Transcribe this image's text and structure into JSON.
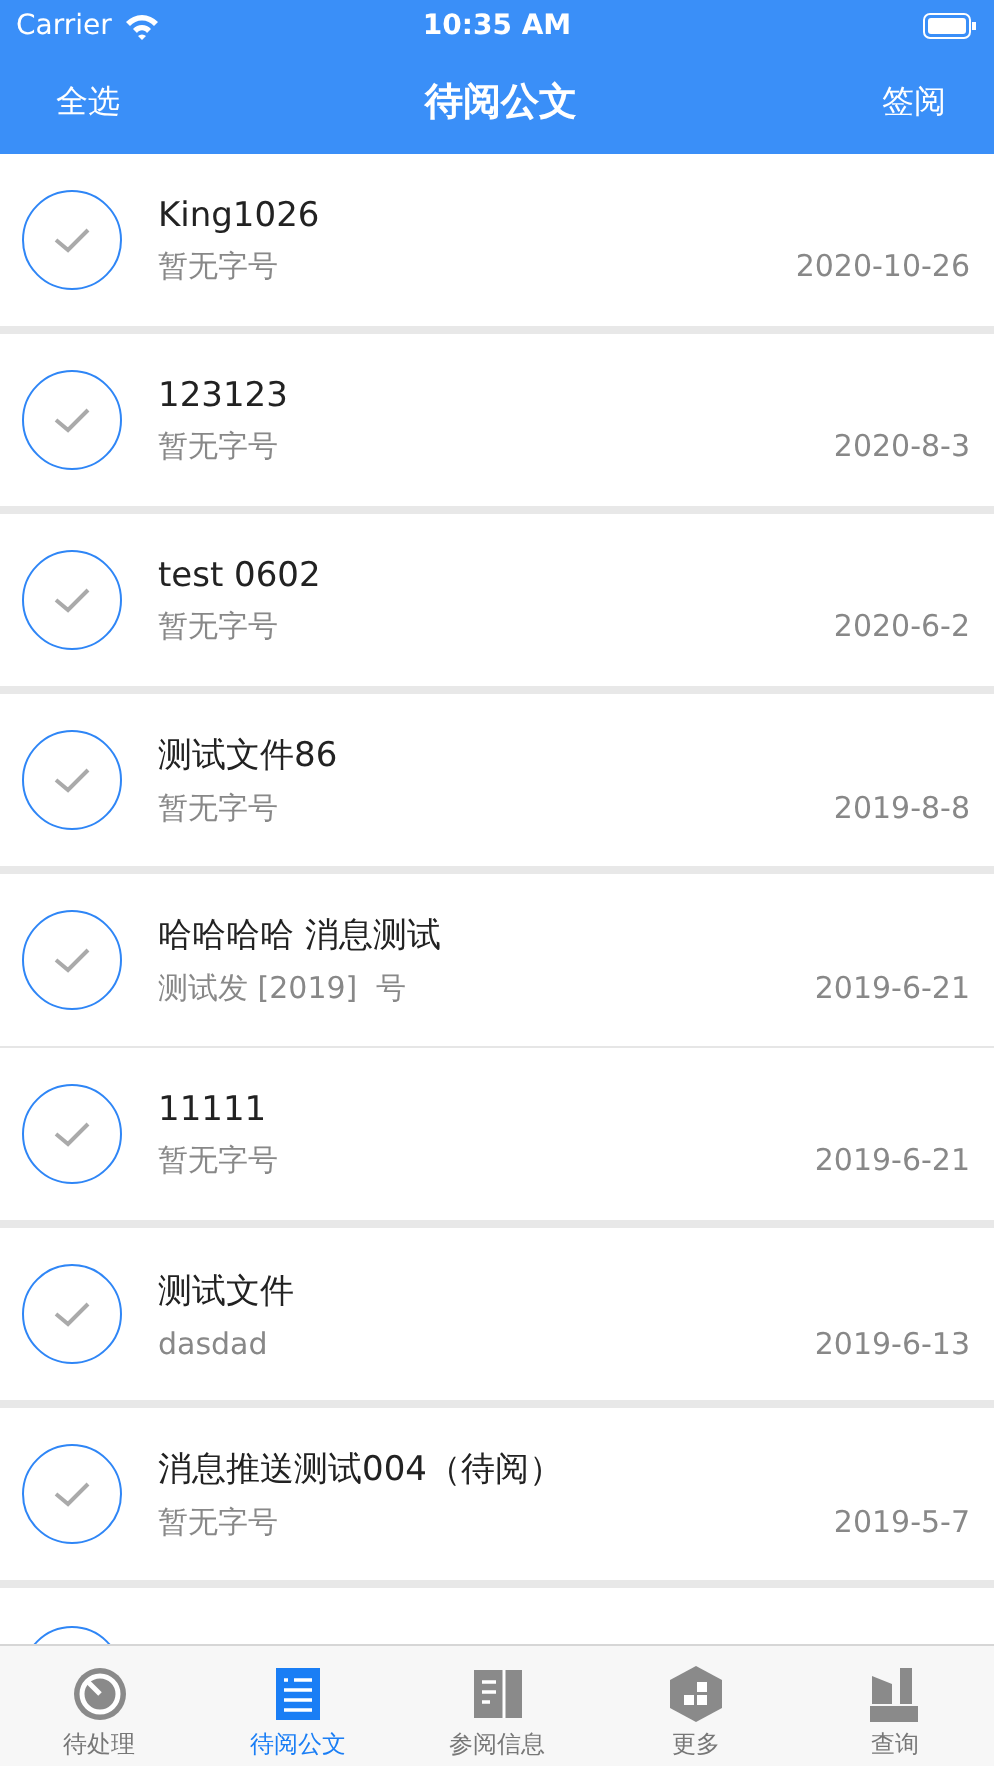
{
  "status_bar": {
    "carrier": "Carrier",
    "time": "10:35 AM"
  },
  "nav": {
    "left": "全选",
    "title": "待阅公文",
    "right": "签阅"
  },
  "documents": [
    {
      "title": "King1026",
      "subtitle": "暂无字号",
      "date": "2020-10-26",
      "checked": false,
      "thin_divider": false
    },
    {
      "title": "123123",
      "subtitle": "暂无字号",
      "date": "2020-8-3",
      "checked": false,
      "thin_divider": false
    },
    {
      "title": "test 0602",
      "subtitle": "暂无字号",
      "date": "2020-6-2",
      "checked": false,
      "thin_divider": false
    },
    {
      "title": "测试文件86",
      "subtitle": "暂无字号",
      "date": "2019-8-8",
      "checked": false,
      "thin_divider": false
    },
    {
      "title": "哈哈哈哈  消息测试",
      "subtitle": "测试发 [2019]  号",
      "date": "2019-6-21",
      "checked": false,
      "thin_divider": true
    },
    {
      "title": "11111",
      "subtitle": "暂无字号",
      "date": "2019-6-21",
      "checked": false,
      "thin_divider": false
    },
    {
      "title": "测试文件",
      "subtitle": "dasdad",
      "date": "2019-6-13",
      "checked": false,
      "thin_divider": false
    },
    {
      "title": "消息推送测试004（待阅）",
      "subtitle": "暂无字号",
      "date": "2019-5-7",
      "checked": false,
      "thin_divider": false
    }
  ],
  "partial_row": {
    "checked": false
  },
  "tabs": [
    {
      "label": "待处理",
      "kind": "timer",
      "selected": false
    },
    {
      "label": "待阅公文",
      "kind": "list",
      "selected": true
    },
    {
      "label": "参阅信息",
      "kind": "book",
      "selected": false
    },
    {
      "label": "更多",
      "kind": "hexagon",
      "selected": false
    },
    {
      "label": "查询",
      "kind": "building",
      "selected": false
    }
  ]
}
